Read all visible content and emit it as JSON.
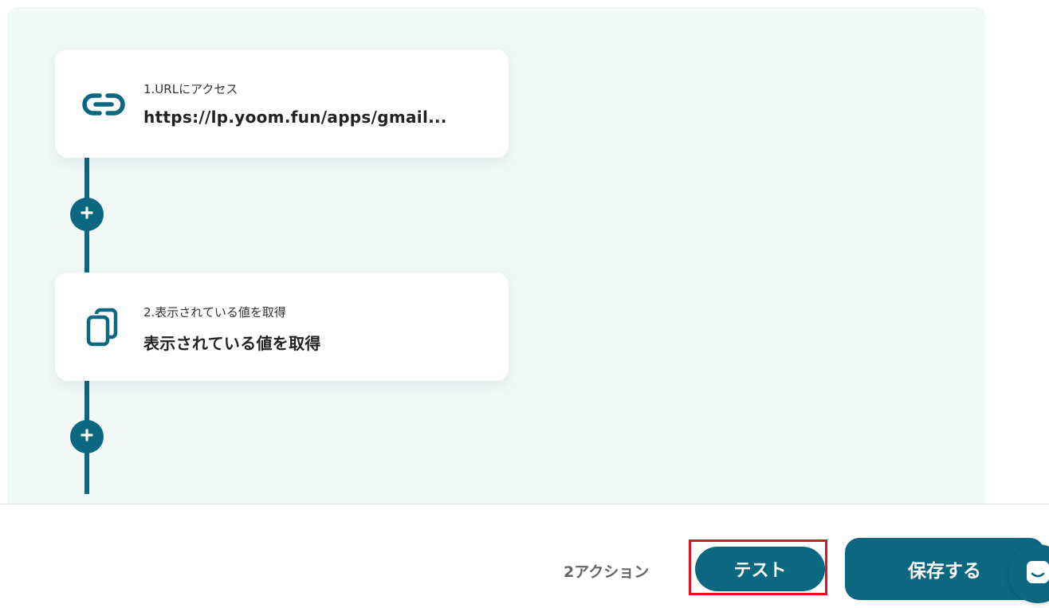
{
  "flow": {
    "steps": [
      {
        "label": "1.URLにアクセス",
        "title": "https://lp.yoom.fun/apps/gmail...",
        "icon": "link-icon"
      },
      {
        "label": "2.表示されている値を取得",
        "title": "表示されている値を取得",
        "icon": "copy-pages-icon"
      }
    ]
  },
  "footer": {
    "action_count": "2アクション",
    "test_label": "テスト",
    "save_label": "保存する"
  },
  "colors": {
    "primary": "#0b6880",
    "canvas_bg": "#f1f9f7",
    "highlight": "#e0141e"
  }
}
